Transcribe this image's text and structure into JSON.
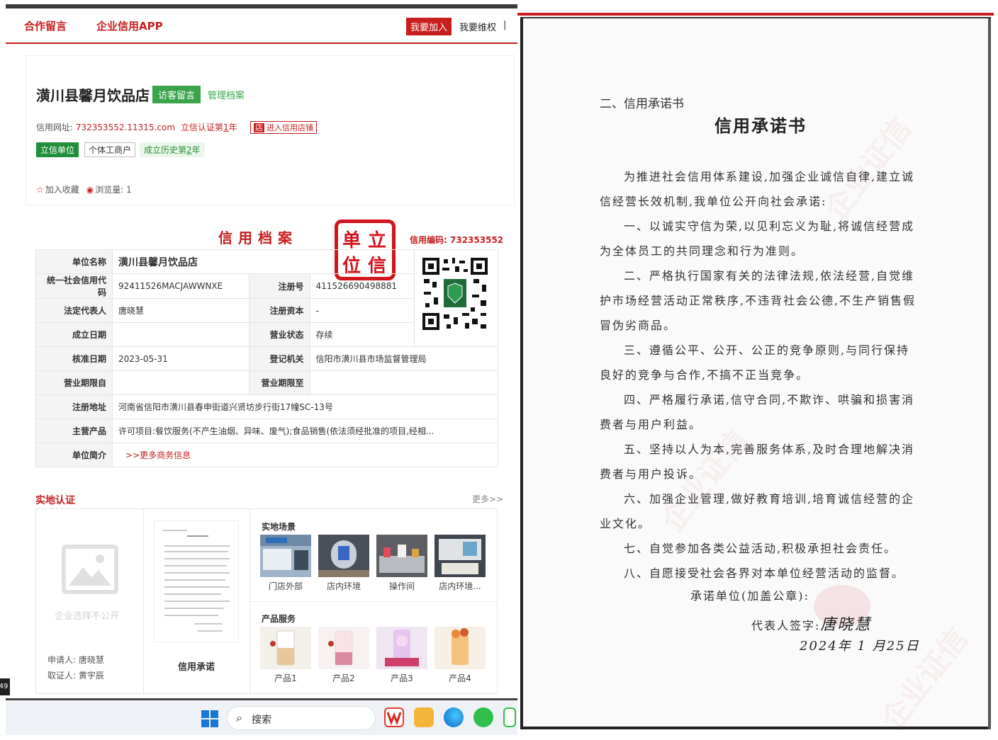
{
  "nav": {
    "link1": "合作留言",
    "link2": "企业信用APP",
    "join": "我要加入",
    "protect": "我要维权",
    "sep": "|"
  },
  "shop": {
    "name": "潢川县馨月饮品店",
    "visit_btn": "访客留言",
    "manage_link": "管理档案",
    "site_label": "信用网址:",
    "site_url": "732353552.11315.com",
    "cert_prefix": "立信认证第",
    "cert_year": "1",
    "cert_suffix": "年",
    "store_mark": "店",
    "store_link": "进入信用店铺",
    "tag_credit": "立信单位",
    "tag_type": "个体工商户",
    "tag_hist_prefix": "成立历史第",
    "tag_hist_year": "2",
    "tag_hist_suffix": "年",
    "favorite": "加入收藏",
    "views_label": "浏览量:",
    "views": "1"
  },
  "archive": {
    "title": "信用档案",
    "seal_chars": [
      "单",
      "立",
      "位",
      "信"
    ],
    "code_label": "信用编码:",
    "code": "732353552",
    "rows": {
      "name_k": "单位名称",
      "name_v": "潢川县馨月饮品店",
      "uscc_k": "统一社会信用代码",
      "uscc_v": "92411526MACJAWWNXE",
      "regno_k": "注册号",
      "regno_v": "411526690498881",
      "rep_k": "法定代表人",
      "rep_v": "唐晓慧",
      "capital_k": "注册资本",
      "capital_v": "-",
      "found_k": "成立日期",
      "found_v": "",
      "status_k": "营业状态",
      "status_v": "存续",
      "approve_k": "核准日期",
      "approve_v": "2023-05-31",
      "authority_k": "登记机关",
      "authority_v": "信阳市潢川县市场监督管理局",
      "term_from_k": "营业期限自",
      "term_from_v": "",
      "term_to_k": "营业期限至",
      "term_to_v": "",
      "addr_k": "注册地址",
      "addr_v": "河南省信阳市潢川县春申街道兴贤坊步行街17幢SC-13号",
      "product_k": "主营产品",
      "product_v": "许可项目:餐饮服务(不产生油烟、异味、废气);食品销售(依法须经批准的项目,经相...",
      "intro_k": "单位简介",
      "intro_v": ">>更多商务信息"
    }
  },
  "field": {
    "title": "实地认证",
    "more": "更多>>",
    "placeholder": "企业选择不公开",
    "applicant_label": "申请人:",
    "applicant": "唐晓慧",
    "witness_label": "取证人:",
    "witness": "黄宇辰",
    "promise_label": "信用承诺",
    "scene_title": "实地场景",
    "scenes": [
      "门店外部",
      "店内环境",
      "操作间",
      "店内环境..."
    ],
    "service_title": "产品服务",
    "products": [
      "产品1",
      "产品2",
      "产品3",
      "产品4"
    ]
  },
  "taskbar": {
    "search": "搜索",
    "edge_num": "49"
  },
  "letter": {
    "heading": "二、信用承诺书",
    "title": "信用承诺书",
    "intro": "为推进社会信用体系建设,加强企业诚信自律,建立诚信经营长效机制,我单位公开向社会承诺:",
    "item1": "一、以诚实守信为荣,以见利忘义为耻,将诚信经营成为全体员工的共同理念和行为准则。",
    "item2": "二、严格执行国家有关的法律法规,依法经营,自觉维护市场经营活动正常秩序,不违背社会公德,不生产销售假冒伪劣商品。",
    "item3": "三、遵循公平、公开、公正的竞争原则,与同行保持良好的竞争与合作,不搞不正当竞争。",
    "item4": "四、严格履行承诺,信守合同,不欺诈、哄骗和损害消费者与用户利益。",
    "item5": "五、坚持以人为本,完善服务体系,及时合理地解决消费者与用户投诉。",
    "item6": "六、加强企业管理,做好教育培训,培育诚信经营的企业文化。",
    "item7": "七、自觉参加各类公益活动,积极承担社会责任。",
    "item8": "八、自愿接受社会各界对本单位经营活动的监督。",
    "unit_line": "承诺单位(加盖公章):",
    "rep_line": "代表人签字:",
    "signature": "唐晓慧",
    "date": "2024年 1 月25日",
    "watermark": "企业证信"
  },
  "colors": {
    "brand_red": "#c81e1e",
    "green": "#3aa44a",
    "seal_red": "#d4141d"
  }
}
